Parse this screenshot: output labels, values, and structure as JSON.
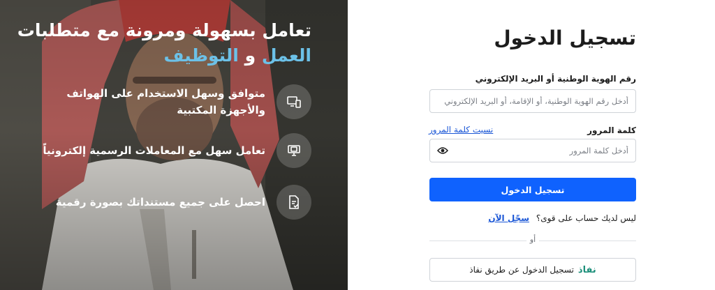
{
  "hero": {
    "title_line1": "تعامل بسهولة ومرونة مع متطلبات",
    "title_accent1": "العمل",
    "title_and": "و",
    "title_accent2": "التوظيف",
    "features": [
      {
        "icon": "devices-icon",
        "text": "متوافق وسهل الاستخدام على الهواتف والأجهزة المكتبية"
      },
      {
        "icon": "monitor-icon",
        "text": "تعامل سهل مع المعاملات الرسمية إلكترونياً"
      },
      {
        "icon": "document-icon",
        "text": "احصل على جميع مستنداتك بصورة رقمية"
      }
    ]
  },
  "login": {
    "title": "تسجيل الدخول",
    "id_label": "رقم الهوية الوطنية أو البريد الإلكتروني",
    "id_placeholder": "أدخل رقم الهوية الوطنية، أو الإقامة، أو البريد الإلكتروني",
    "password_label": "كلمة المرور",
    "forgot_link": "نسيت كلمة المرور",
    "password_placeholder": "أدخل كلمة المرور",
    "submit_label": "تسجيل الدخول",
    "no_account_text": "ليس لديك حساب على قوى؟",
    "register_link": "سجّل الآن",
    "or_text": "أو",
    "nafath_brand": "نفاذ",
    "nafath_label": "تسجيل الدخول عن طريق نفاذ"
  },
  "colors": {
    "primary": "#0f62fe",
    "link": "#1a56d6",
    "accent": "#6cc1e8",
    "nafath": "#1c8f7a"
  }
}
